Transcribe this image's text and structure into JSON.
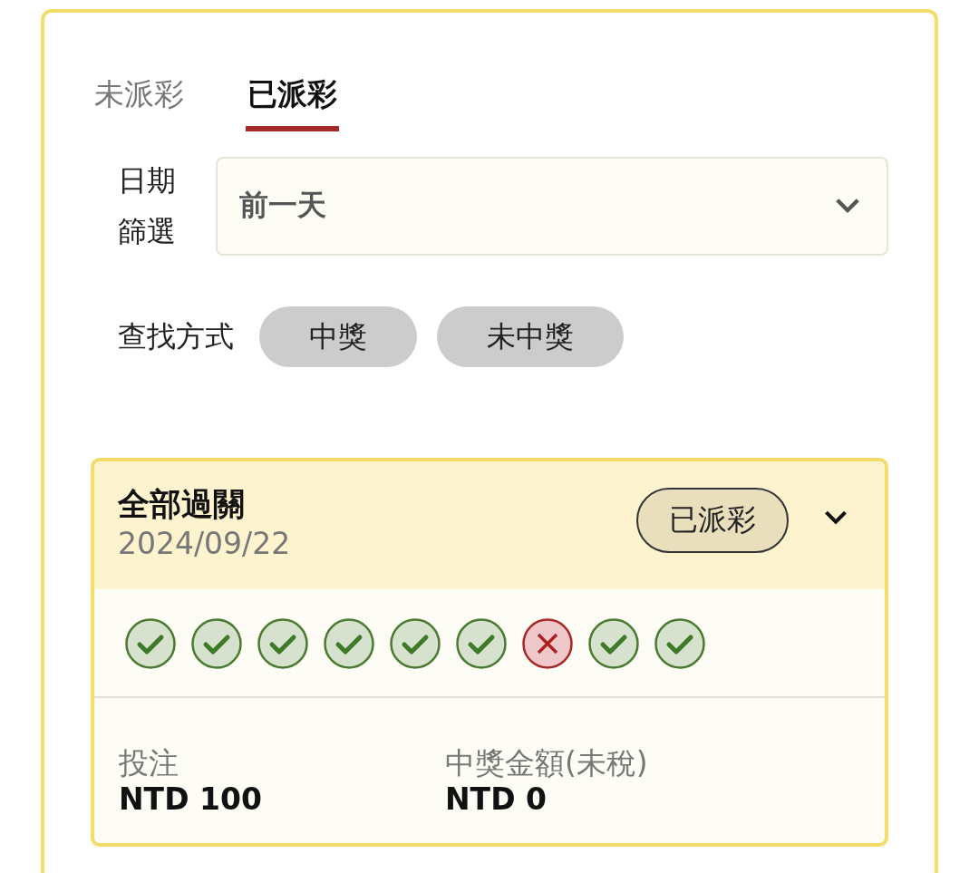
{
  "tabs": [
    {
      "label": "未派彩",
      "selected": false
    },
    {
      "label": "已派彩",
      "selected": true
    }
  ],
  "date_filter": {
    "label": "日期篩選",
    "value": "前一天"
  },
  "search_method": {
    "label": "查找方式",
    "options": [
      {
        "label": "中獎",
        "selected": false
      },
      {
        "label": "未中獎",
        "selected": false
      }
    ]
  },
  "bet_card": {
    "title": "全部過關",
    "date": "2024/09/22",
    "status": "已派彩",
    "expanded": false,
    "results": [
      {
        "kind": "win"
      },
      {
        "kind": "win"
      },
      {
        "kind": "win"
      },
      {
        "kind": "win"
      },
      {
        "kind": "win"
      },
      {
        "kind": "win"
      },
      {
        "kind": "loss"
      },
      {
        "kind": "win"
      },
      {
        "kind": "win"
      }
    ],
    "stake": {
      "label": "投注",
      "value": "NTD 100"
    },
    "payout": {
      "label": "中獎金額(未稅)",
      "value": "NTD 0"
    }
  }
}
